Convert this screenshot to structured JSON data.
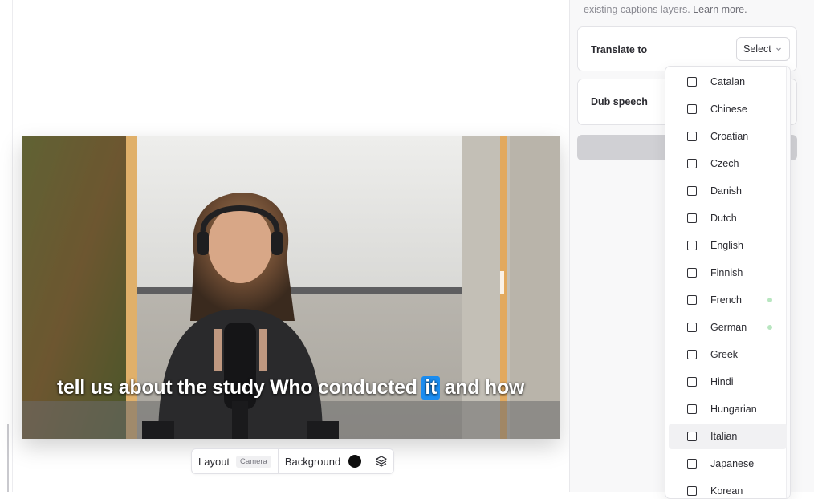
{
  "panel": {
    "help_text_partial": "existing captions layers.",
    "help_link": "Learn more.",
    "translate": {
      "label": "Translate to",
      "select_value": "Select"
    },
    "dub": {
      "label": "Dub speech"
    }
  },
  "languages": [
    {
      "name": "Catalan",
      "checked": false,
      "badge": false
    },
    {
      "name": "Chinese",
      "checked": false,
      "badge": false
    },
    {
      "name": "Croatian",
      "checked": false,
      "badge": false
    },
    {
      "name": "Czech",
      "checked": false,
      "badge": false
    },
    {
      "name": "Danish",
      "checked": false,
      "badge": false
    },
    {
      "name": "Dutch",
      "checked": false,
      "badge": false
    },
    {
      "name": "English",
      "checked": false,
      "badge": false
    },
    {
      "name": "Finnish",
      "checked": false,
      "badge": false
    },
    {
      "name": "French",
      "checked": false,
      "badge": true
    },
    {
      "name": "German",
      "checked": false,
      "badge": true
    },
    {
      "name": "Greek",
      "checked": false,
      "badge": false
    },
    {
      "name": "Hindi",
      "checked": false,
      "badge": false
    },
    {
      "name": "Hungarian",
      "checked": false,
      "badge": false
    },
    {
      "name": "Italian",
      "checked": false,
      "badge": false,
      "hovered": true
    },
    {
      "name": "Japanese",
      "checked": false,
      "badge": false
    },
    {
      "name": "Korean",
      "checked": false,
      "badge": false
    }
  ],
  "caption": {
    "words": [
      "tell",
      "us",
      "about",
      "the",
      "study",
      "Who",
      "conducted",
      "it",
      "and",
      "how"
    ],
    "highlight_index": 7,
    "highlight_color": "#1a8cf0"
  },
  "toolbar": {
    "layout_label": "Layout",
    "layout_value": "Camera",
    "background_label": "Background",
    "background_color": "#0e0e0e"
  },
  "colors": {
    "badge": "#b8e6c0",
    "action_bar": "#d0d0d4"
  }
}
